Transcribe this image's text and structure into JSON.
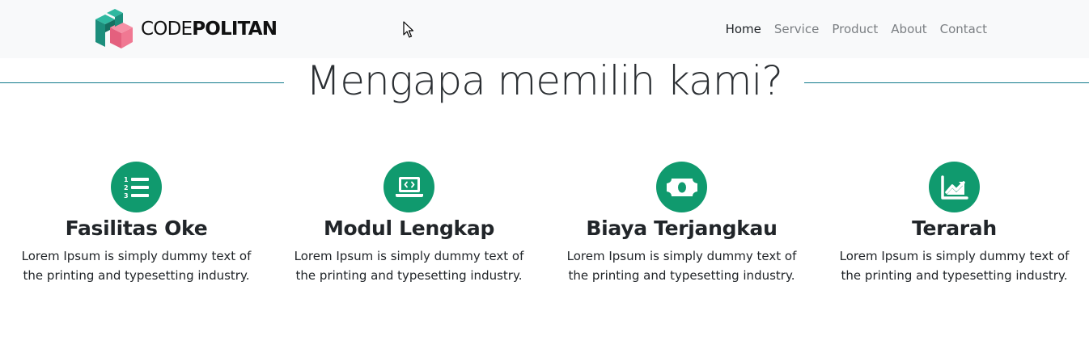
{
  "brand": {
    "name_part1": "CODE",
    "name_part2": "POLITAN"
  },
  "nav": {
    "items": [
      {
        "label": "Home",
        "active": true
      },
      {
        "label": "Service",
        "active": false
      },
      {
        "label": "Product",
        "active": false
      },
      {
        "label": "About",
        "active": false
      },
      {
        "label": "Contact",
        "active": false
      }
    ]
  },
  "section": {
    "title": "Mengapa memilih kami?"
  },
  "features": [
    {
      "icon": "list-ol-icon",
      "title": "Fasilitas Oke",
      "text": "Lorem Ipsum is simply dummy text of the printing and typesetting industry."
    },
    {
      "icon": "laptop-code-icon",
      "title": "Modul Lengkap",
      "text": "Lorem Ipsum is simply dummy text of the printing and typesetting industry."
    },
    {
      "icon": "money-bill-icon",
      "title": "Biaya Terjangkau",
      "text": "Lorem Ipsum is simply dummy text of the printing and typesetting industry."
    },
    {
      "icon": "chart-area-icon",
      "title": "Terarah",
      "text": "Lorem Ipsum is simply dummy text of the printing and typesetting industry."
    }
  ],
  "colors": {
    "accent": "#109a6e",
    "rule": "#117a8b",
    "navbar_bg": "#f8f9fa"
  }
}
